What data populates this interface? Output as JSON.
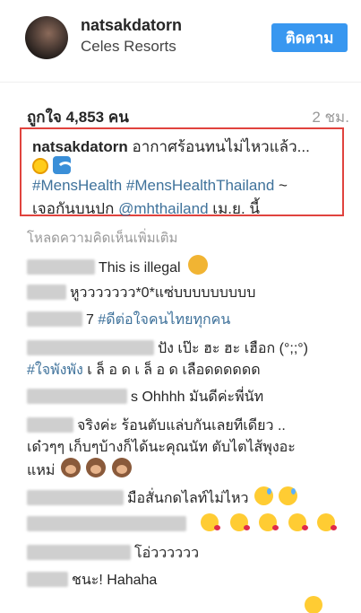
{
  "header": {
    "username": "natsakdatorn",
    "location": "Celes Resorts",
    "follow_label": "ติดตาม"
  },
  "stats": {
    "likes": "ถูกใจ 4,853 คน",
    "time": "2 ชม."
  },
  "caption": {
    "username": "natsakdatorn",
    "text": "อากาศร้อนทนไม่ไหวแล้ว...",
    "emojis": [
      "sun-icon",
      "wave-icon"
    ],
    "tag1": "#MensHealth",
    "tag2": "#MensHealthThailand",
    "tag2_suffix": " ~",
    "line3_prefix": "เจอกันบนปก ",
    "mention": "@mhthailand",
    "line3_suffix": " เม.ย. นี้"
  },
  "load_more": "โหลดความคิดเห็นเพิ่มเติม",
  "comments": [
    {
      "user_visible": "",
      "text": "This is illegal"
    },
    {
      "user_visible": "",
      "text": "หูววววววว*0*แซ่บบบบบบบบบ"
    },
    {
      "user_visible": "7",
      "tag": "#ดีต่อใจคนไทยทุกคน"
    },
    {
      "text": "ปัง เป๊ะ ฮะ ฮะ เฮือก (°;;°)",
      "tag": "#ใจพังพัง",
      "text2": " เ ล็ อ ด เ ล็ อ ด เลือดดดดดด"
    },
    {
      "user_visible": "s",
      "text": "Ohhhh มันดีค่ะพี่นัท"
    },
    {
      "text": "จริงค่ะ ร้อนตับแล่บกันเลยทีเดียว ..",
      "text2": "เด๋วๆๆ เก็บๆบ้างก็ได้นะคุณนัท ตับไตไส้พุงอะ",
      "text3": "แหม่"
    },
    {
      "text": "มือสั่นกดไลท์ไม่ไหว"
    },
    {
      "text": ""
    },
    {
      "text": "โอ่วววววว"
    },
    {
      "text": "ชนะ! Hahaha"
    }
  ],
  "colors": {
    "follow_button": "#3897f0",
    "hashtag": "#3f729b",
    "highlight_border": "#e0433e"
  }
}
